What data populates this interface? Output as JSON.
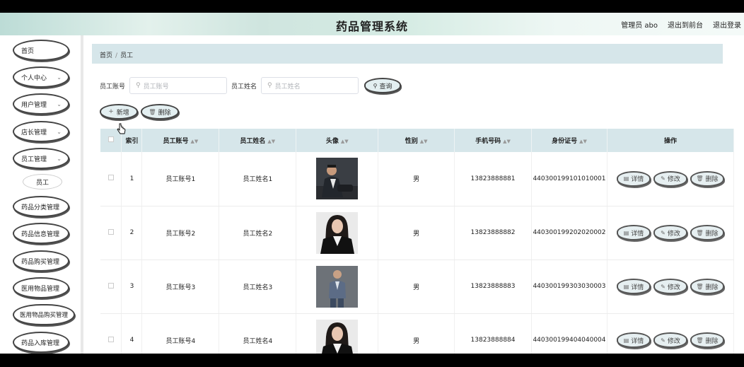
{
  "header": {
    "title": "药品管理系统",
    "user_label": "管理员 abo",
    "front_link": "退出到前台",
    "logout_link": "退出登录"
  },
  "sidebar": {
    "items": [
      {
        "label": "首页",
        "chevron": false
      },
      {
        "label": "个人中心",
        "chevron": true
      },
      {
        "label": "用户管理",
        "chevron": true
      },
      {
        "label": "店长管理",
        "chevron": true
      },
      {
        "label": "员工管理",
        "chevron": true
      },
      {
        "label": "药品分类管理",
        "chevron": false
      },
      {
        "label": "药品信息管理",
        "chevron": false
      },
      {
        "label": "药品购买管理",
        "chevron": false
      },
      {
        "label": "医用物品管理",
        "chevron": false
      },
      {
        "label": "医用物品购买管理",
        "chevron": false
      },
      {
        "label": "药品入库管理",
        "chevron": false
      }
    ],
    "submenu_label": "员工"
  },
  "breadcrumb": {
    "home": "首页",
    "separator": "/",
    "current": "员工"
  },
  "search": {
    "account_label": "员工账号",
    "account_placeholder": "员工账号",
    "name_label": "员工姓名",
    "name_placeholder": "员工姓名",
    "query_button": "查询"
  },
  "actions": {
    "add_button": "新增",
    "delete_button": "删除"
  },
  "table": {
    "columns": [
      "索引",
      "员工账号",
      "员工姓名",
      "头像",
      "性别",
      "手机号码",
      "身份证号",
      "操作"
    ],
    "rows": [
      {
        "index": "1",
        "account": "员工账号1",
        "name": "员工姓名1",
        "gender": "男",
        "phone": "13823888881",
        "id_card": "440300199101010001",
        "avatar": "man-dark-suit-seated"
      },
      {
        "index": "2",
        "account": "员工账号2",
        "name": "员工姓名2",
        "gender": "男",
        "phone": "13823888882",
        "id_card": "440300199202020002",
        "avatar": "woman-black-blazer"
      },
      {
        "index": "3",
        "account": "员工账号3",
        "name": "员工姓名3",
        "gender": "男",
        "phone": "13823888883",
        "id_card": "440300199303030003",
        "avatar": "man-grey-suit-standing"
      },
      {
        "index": "4",
        "account": "员工账号4",
        "name": "员工姓名4",
        "gender": "男",
        "phone": "13823888884",
        "id_card": "440300199404040004",
        "avatar": "woman-black-blazer"
      }
    ],
    "row_actions": {
      "detail": "详情",
      "edit": "修改",
      "delete": "删除"
    }
  },
  "colors": {
    "accent": "#d6e6ea",
    "button_bg": "#e3eff1",
    "border_dark": "#444444"
  }
}
